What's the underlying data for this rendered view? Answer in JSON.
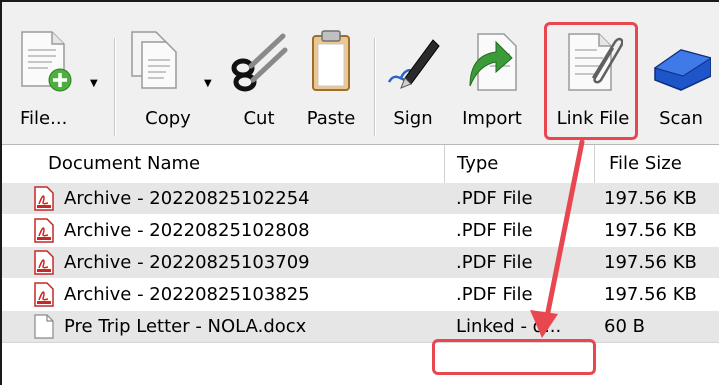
{
  "toolbar": {
    "buttons": [
      {
        "label": "File...",
        "icon": "new-document-plus-icon",
        "has_dropdown": true
      },
      {
        "label": "Copy",
        "icon": "copy-documents-icon",
        "has_dropdown": true
      },
      {
        "label": "Cut",
        "icon": "scissors-icon",
        "has_dropdown": false
      },
      {
        "label": "Paste",
        "icon": "clipboard-icon",
        "has_dropdown": false
      },
      {
        "label": "Sign",
        "icon": "pen-signature-icon",
        "has_dropdown": false
      },
      {
        "label": "Import",
        "icon": "import-arrow-icon",
        "has_dropdown": false
      },
      {
        "label": "Link File",
        "icon": "paperclip-document-icon",
        "has_dropdown": false,
        "highlighted": true
      },
      {
        "label": "Scan",
        "icon": "scanner-icon",
        "has_dropdown": false
      }
    ]
  },
  "table": {
    "columns": [
      "Document Name",
      "Type",
      "File Size"
    ],
    "rows": [
      {
        "icon": "pdf-file-icon",
        "name": "Archive - 20220825102254",
        "type": ".PDF File",
        "size": "197.56 KB"
      },
      {
        "icon": "pdf-file-icon",
        "name": "Archive - 20220825102808",
        "type": ".PDF File",
        "size": "197.56 KB"
      },
      {
        "icon": "pdf-file-icon",
        "name": "Archive - 20220825103709",
        "type": ".PDF File",
        "size": "197.56 KB"
      },
      {
        "icon": "pdf-file-icon",
        "name": "Archive - 20220825103825",
        "type": ".PDF File",
        "size": "197.56 KB"
      },
      {
        "icon": "blank-file-icon",
        "name": "Pre Trip Letter - NOLA.docx",
        "type": "Linked - d...",
        "size": "60 B",
        "highlighted": true
      }
    ]
  },
  "annotation": {
    "color": "#e8474f"
  }
}
